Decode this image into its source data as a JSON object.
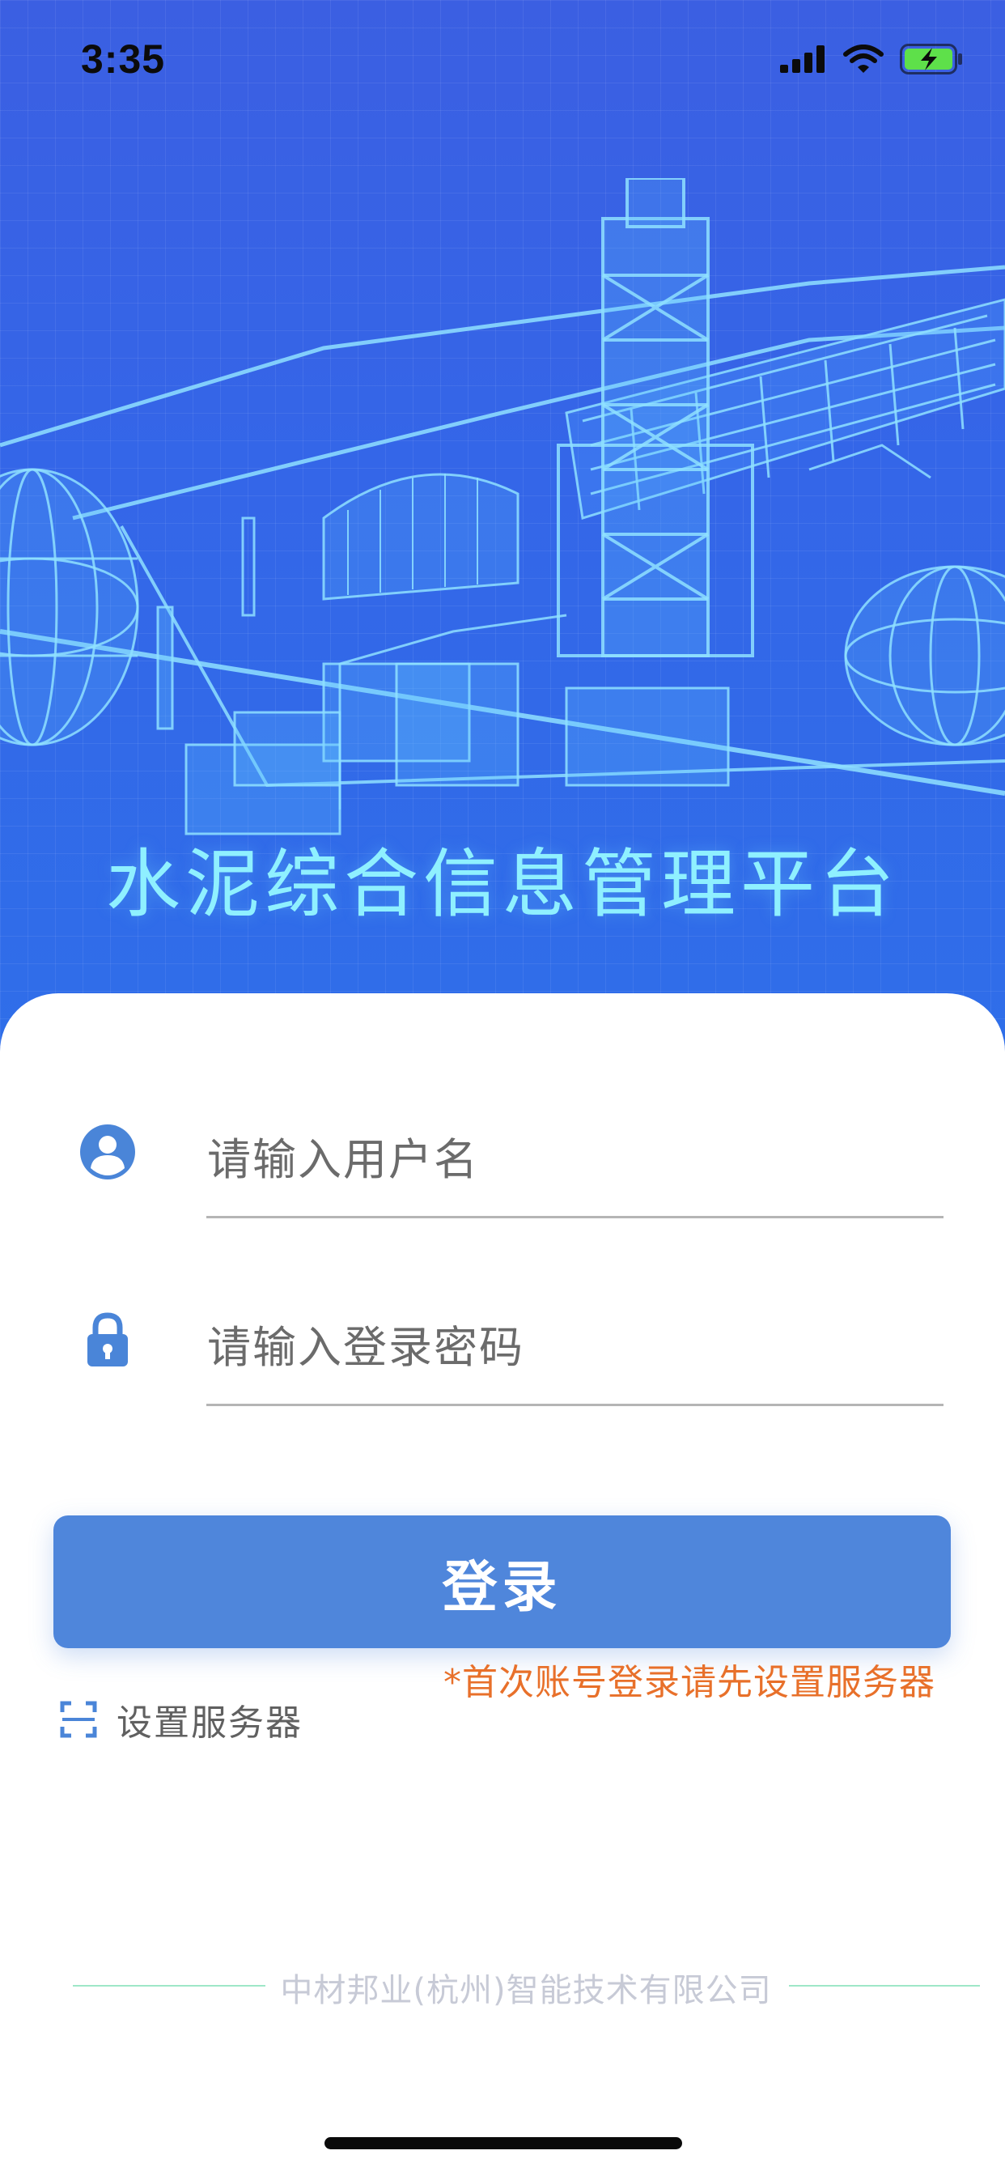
{
  "status_bar": {
    "time": "3:35"
  },
  "header": {
    "title": "水泥综合信息管理平台"
  },
  "login": {
    "username_placeholder": "请输入用户名",
    "password_placeholder": "请输入登录密码",
    "login_button": "登录",
    "first_login_note": "*首次账号登录请先设置服务器",
    "set_server_label": "设置服务器"
  },
  "footer": {
    "company": "中材邦业(杭州)智能技术有限公司"
  },
  "colors": {
    "hero_blue": "#3466e8",
    "title_cyan": "#8ff0ff",
    "button_blue": "#4f86db",
    "icon_blue": "#4a85d8",
    "note_orange": "#e8702a",
    "battery_green": "#5ee04a"
  },
  "icons": [
    "signal-icon",
    "wifi-icon",
    "battery-charging-icon",
    "user-icon",
    "lock-icon",
    "scan-icon"
  ]
}
